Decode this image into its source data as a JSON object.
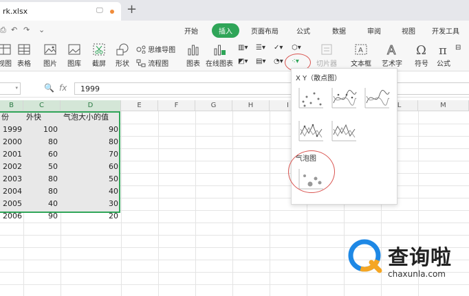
{
  "window": {
    "tab_title": "rk.xlsx",
    "new_tab": "+"
  },
  "quick_access": {
    "print": "⎙",
    "undo": "↶",
    "redo": "↷",
    "more": "⌄"
  },
  "menu": {
    "items": [
      "开始",
      "插入",
      "页面布局",
      "公式",
      "数据",
      "审阅",
      "视图",
      "开发工具"
    ],
    "active_index": 1,
    "accent": "#2fa558"
  },
  "ribbon": {
    "pivot_view": "视图",
    "table": "表格",
    "picture": "图片",
    "gallery": "图库",
    "screenshot": "截屏",
    "shape": "形状",
    "mindmap": "思维导图",
    "flowchart": "流程图",
    "chart": "图表",
    "online_chart": "在线图表",
    "slicer": "切片器",
    "textbox": "文本框",
    "wordart": "艺术字",
    "symbol": "符号",
    "formula": "公式"
  },
  "formula_bar": {
    "name_box": "",
    "value": "1999",
    "fx": "fx"
  },
  "columns": [
    "B",
    "C",
    "D",
    "E",
    "F",
    "G",
    "H",
    "I",
    "J",
    "K",
    "L",
    "M"
  ],
  "table": {
    "headers": [
      "份",
      "外快",
      "气泡大小的值"
    ],
    "rows": [
      [
        "1999",
        "100",
        "90"
      ],
      [
        "2000",
        "80",
        "80"
      ],
      [
        "2001",
        "60",
        "70"
      ],
      [
        "2002",
        "50",
        "60"
      ],
      [
        "2003",
        "80",
        "50"
      ],
      [
        "2004",
        "80",
        "40"
      ],
      [
        "2005",
        "40",
        "30"
      ],
      [
        "2006",
        "90",
        "20"
      ]
    ]
  },
  "chart_menu": {
    "xy_heading": "X Y（散点图）",
    "bubble_heading": "气泡图"
  },
  "watermark": {
    "brand": "查询啦",
    "url": "chaxunla.com"
  }
}
